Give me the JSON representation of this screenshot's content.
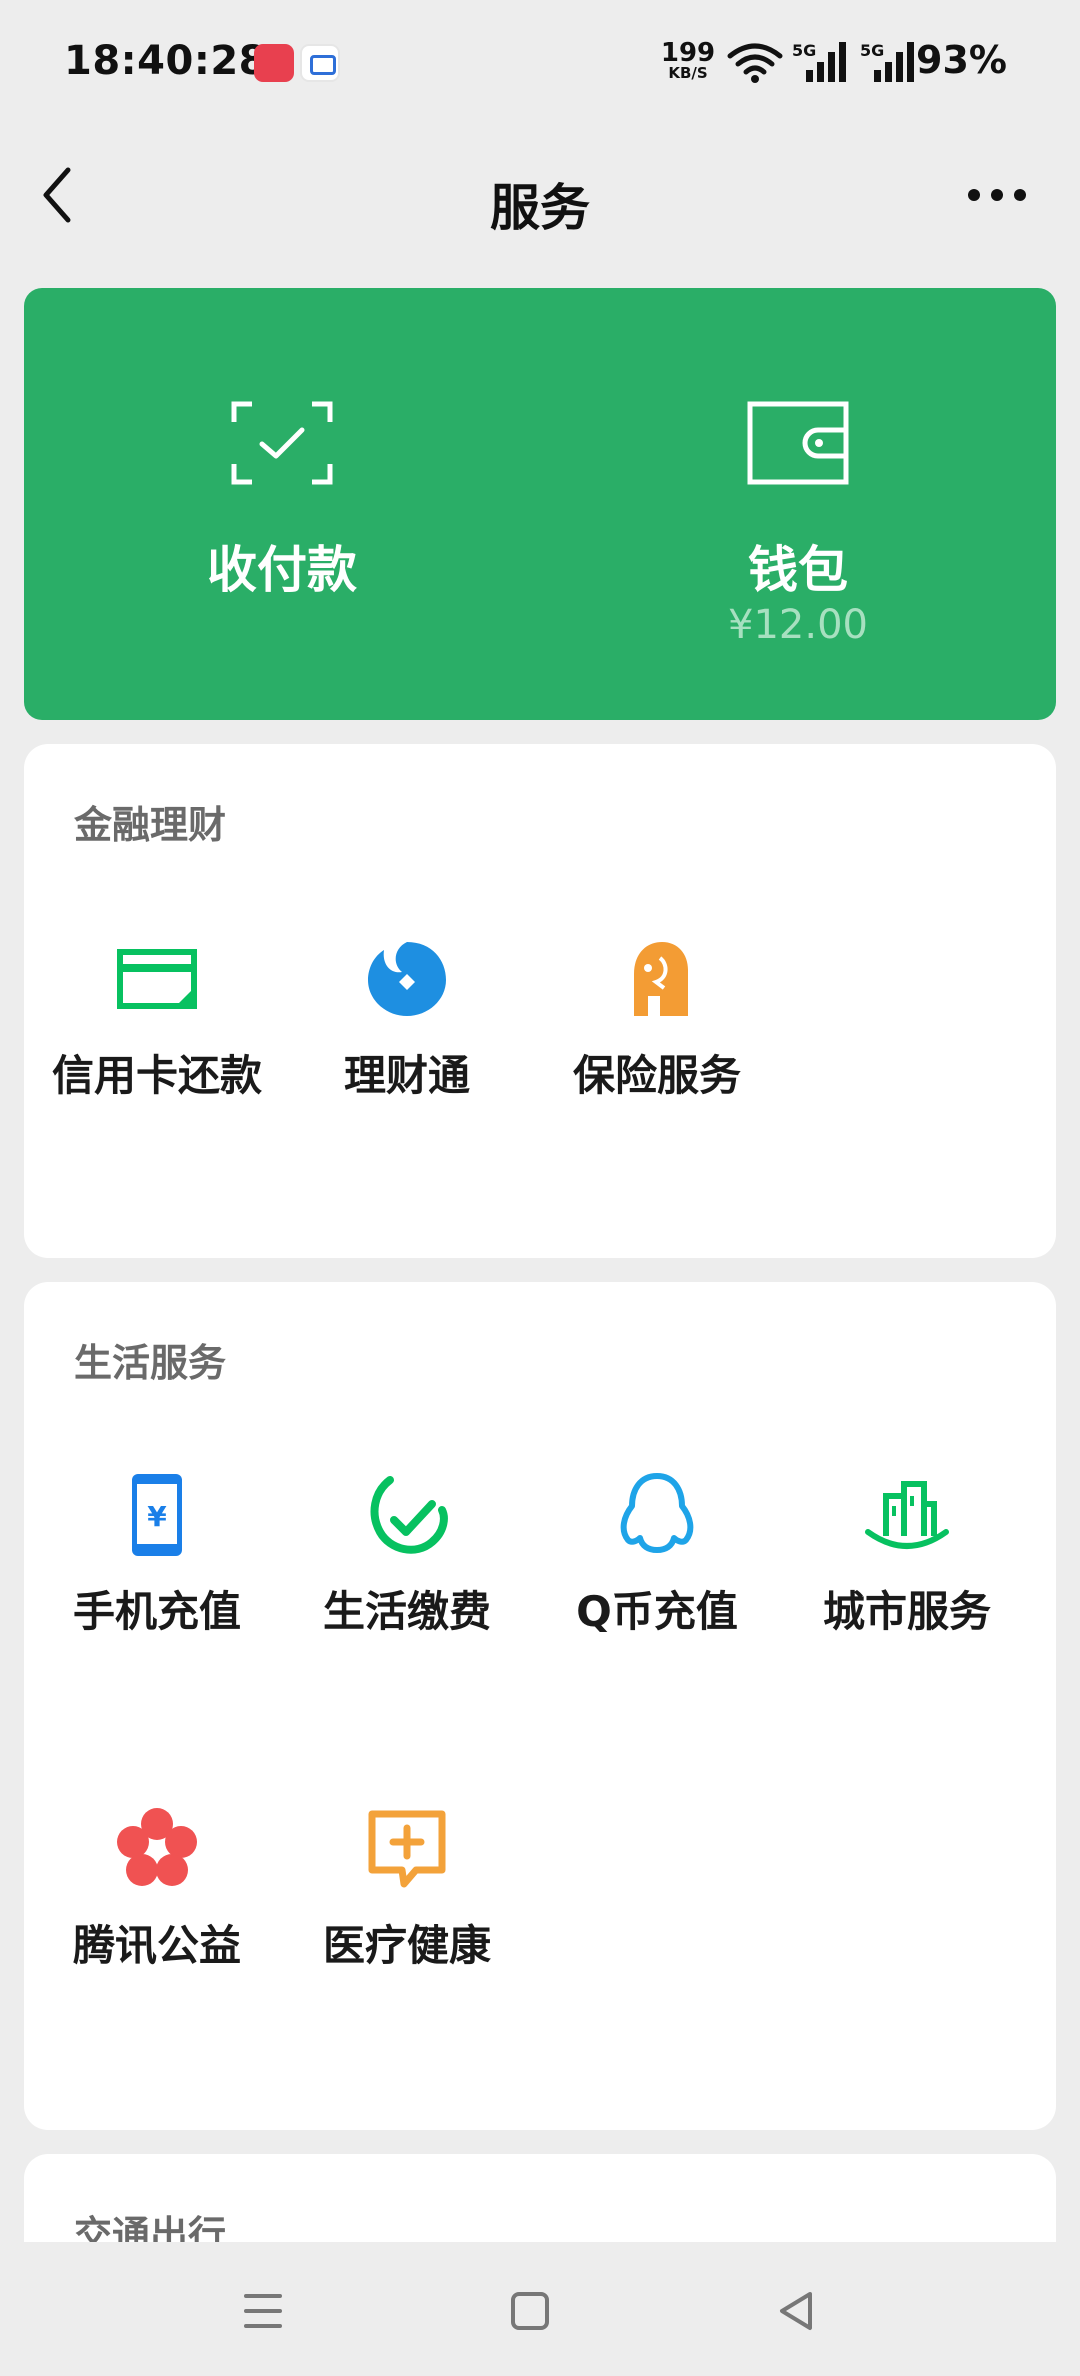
{
  "status_bar": {
    "time": "18:40:28",
    "net_speed_value": "199",
    "net_speed_unit": "KB/S",
    "signal1_label": "5G",
    "signal2_label": "5G",
    "battery": "93%"
  },
  "header": {
    "title": "服务",
    "back_icon": "chevron-left",
    "more_icon": "ellipsis"
  },
  "pay_card": {
    "color": "#2aae67",
    "pay_label": "收付款",
    "pay_icon": "scan-check",
    "wallet_label": "钱包",
    "wallet_icon": "wallet",
    "wallet_amount": "¥12.00"
  },
  "finance": {
    "title": "金融理财",
    "items": [
      {
        "label": "信用卡还款",
        "icon": "credit-card",
        "color": "#07c160"
      },
      {
        "label": "理财通",
        "icon": "licaitong",
        "color": "#1e8fe1"
      },
      {
        "label": "保险服务",
        "icon": "insurance",
        "color": "#f39c34"
      }
    ]
  },
  "life": {
    "title": "生活服务",
    "items": [
      {
        "label": "手机充值",
        "icon": "phone-yuan",
        "color": "#1a7fe8"
      },
      {
        "label": "生活缴费",
        "icon": "check-circle",
        "color": "#07c160"
      },
      {
        "label": "Q币充值",
        "icon": "penguin",
        "color": "#1fa4e8"
      },
      {
        "label": "城市服务",
        "icon": "city",
        "color": "#07c160"
      },
      {
        "label": "腾讯公益",
        "icon": "flower",
        "color": "#f05252"
      },
      {
        "label": "医疗健康",
        "icon": "medical",
        "color": "#f3a23a"
      }
    ]
  },
  "traffic": {
    "title": "交通出行"
  }
}
